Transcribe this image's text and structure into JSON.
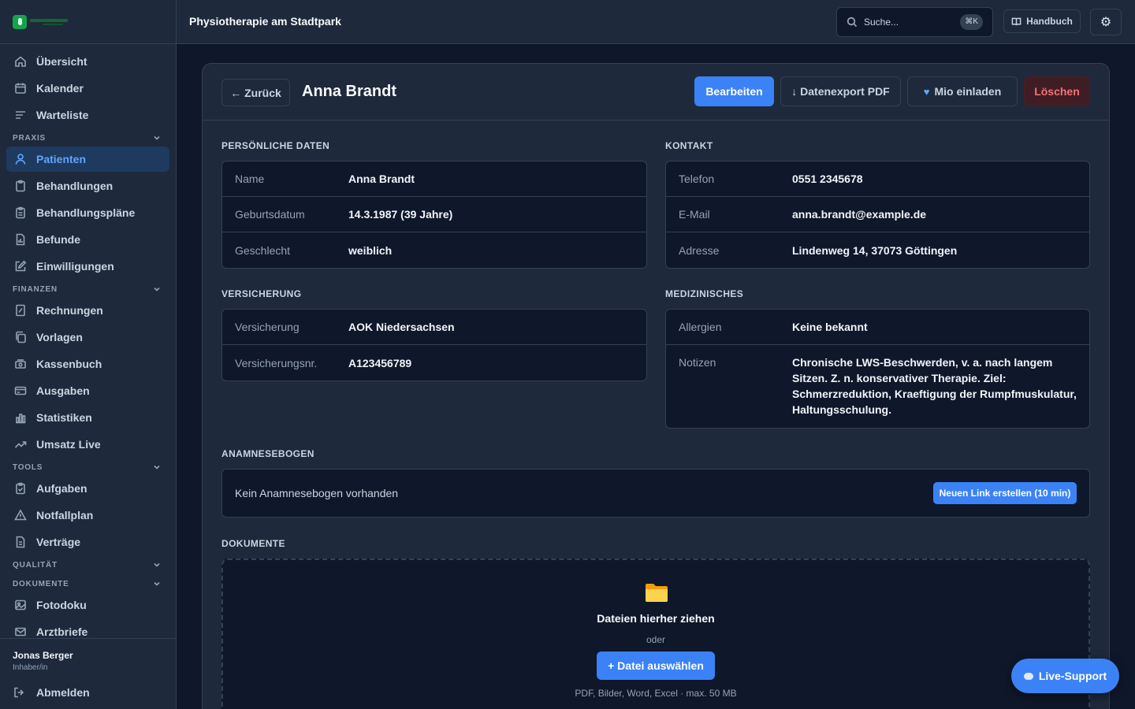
{
  "topbar": {
    "title": "Physiotherapie am Stadtpark",
    "search_placeholder": "Suche...",
    "search_shortcut": "⌘K",
    "handbook_label": "Handbuch"
  },
  "sidebar": {
    "top_items": [
      {
        "label": "Übersicht",
        "icon": "home-icon"
      },
      {
        "label": "Kalender",
        "icon": "calendar-icon"
      },
      {
        "label": "Warteliste",
        "icon": "list-icon"
      }
    ],
    "sections": [
      {
        "title": "PRAXIS",
        "items": [
          {
            "label": "Patienten",
            "icon": "user-icon",
            "active": true
          },
          {
            "label": "Behandlungen",
            "icon": "clipboard-icon"
          },
          {
            "label": "Behandlungspläne",
            "icon": "clipboard-list-icon"
          },
          {
            "label": "Befunde",
            "icon": "document-chart-icon"
          },
          {
            "label": "Einwilligungen",
            "icon": "edit-icon"
          }
        ]
      },
      {
        "title": "FINANZEN",
        "items": [
          {
            "label": "Rechnungen",
            "icon": "receipt-icon"
          },
          {
            "label": "Vorlagen",
            "icon": "copy-icon"
          },
          {
            "label": "Kassenbuch",
            "icon": "cash-icon"
          },
          {
            "label": "Ausgaben",
            "icon": "credit-card-icon"
          },
          {
            "label": "Statistiken",
            "icon": "bar-chart-icon"
          },
          {
            "label": "Umsatz Live",
            "icon": "trend-icon"
          }
        ]
      },
      {
        "title": "TOOLS",
        "items": [
          {
            "label": "Aufgaben",
            "icon": "clipboard-check-icon"
          },
          {
            "label": "Notfallplan",
            "icon": "warning-icon"
          },
          {
            "label": "Verträge",
            "icon": "document-icon"
          }
        ]
      },
      {
        "title": "QUALITÄT",
        "items": []
      },
      {
        "title": "DOKUMENTE",
        "items": [
          {
            "label": "Fotodoku",
            "icon": "image-icon"
          },
          {
            "label": "Arztbriefe",
            "icon": "mail-icon"
          }
        ]
      }
    ],
    "user": {
      "name": "Jonas Berger",
      "role": "Inhaber/in"
    },
    "logout_label": "Abmelden"
  },
  "header": {
    "back_label": "← Zurück",
    "patient_name": "Anna Brandt",
    "edit_label": "Bearbeiten",
    "export_label": "↓ Datenexport PDF",
    "invite_label": "Mio einladen",
    "delete_label": "Löschen"
  },
  "personal": {
    "title": "PERSÖNLICHE DATEN",
    "rows": [
      {
        "label": "Name",
        "value": "Anna Brandt"
      },
      {
        "label": "Geburtsdatum",
        "value": "14.3.1987 (39 Jahre)"
      },
      {
        "label": "Geschlecht",
        "value": "weiblich"
      }
    ]
  },
  "contact": {
    "title": "KONTAKT",
    "rows": [
      {
        "label": "Telefon",
        "value": "0551 2345678"
      },
      {
        "label": "E-Mail",
        "value": "anna.brandt@example.de"
      },
      {
        "label": "Adresse",
        "value": "Lindenweg 14, 37073 Göttingen"
      }
    ]
  },
  "insurance": {
    "title": "VERSICHERUNG",
    "rows": [
      {
        "label": "Versicherung",
        "value": "AOK Niedersachsen"
      },
      {
        "label": "Versicherungsnr.",
        "value": "A123456789"
      }
    ]
  },
  "medical": {
    "title": "MEDIZINISCHES",
    "rows": [
      {
        "label": "Allergien",
        "value": "Keine bekannt"
      },
      {
        "label": "Notizen",
        "value": "Chronische LWS-Beschwerden, v. a. nach langem Sitzen. Z. n. konservativer Therapie. Ziel: Schmerzreduktion, Kraeftigung der Rumpfmuskulatur, Haltungsschulung."
      }
    ]
  },
  "anamnesis": {
    "title": "ANAMNESEBOGEN",
    "empty_text": "Kein Anamnesebogen vorhanden",
    "button_label": "Neuen Link erstellen (10 min)"
  },
  "documents": {
    "title": "DOKUMENTE",
    "drop_title": "Dateien hierher ziehen",
    "or_label": "oder",
    "button_label": "+ Datei auswählen",
    "hint": "PDF, Bilder, Word, Excel · max. 50 MB"
  },
  "live_support_label": "Live-Support",
  "colors": {
    "background": "#0f172a",
    "surface": "#1e293b",
    "border": "#334155",
    "accent": "#3b82f6",
    "danger": "#f87171"
  }
}
